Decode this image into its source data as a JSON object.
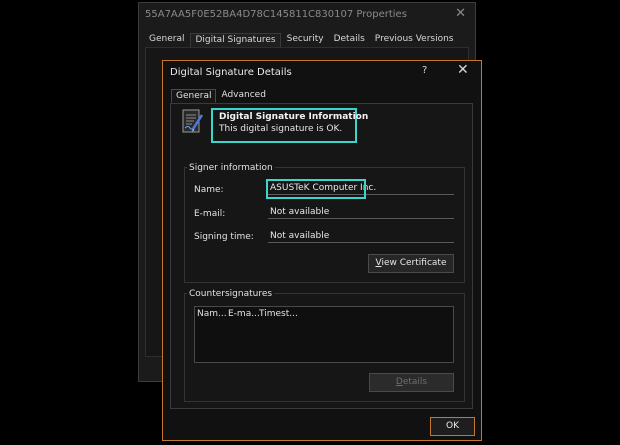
{
  "background_window": {
    "title": "55A7AA5F0E52BA4D78C145811C830107 Properties",
    "close_glyph": "✕",
    "tabs": [
      {
        "label": "General"
      },
      {
        "label": "Digital Signatures"
      },
      {
        "label": "Security"
      },
      {
        "label": "Details"
      },
      {
        "label": "Previous Versions"
      }
    ]
  },
  "dialog": {
    "title": "Digital Signature Details",
    "help_glyph": "?",
    "close_glyph": "✕",
    "tabs": [
      {
        "label": "General"
      },
      {
        "label": "Advanced"
      }
    ],
    "info": {
      "heading": "Digital Signature Information",
      "status": "This digital signature is OK."
    },
    "signer": {
      "group_label": "Signer information",
      "name_label": "Name:",
      "name_value": "ASUSTeK Computer Inc.",
      "email_label": "E-mail:",
      "email_value": "Not available",
      "time_label": "Signing time:",
      "time_value": "Not available",
      "view_cert_underlined": "V",
      "view_cert_rest": "iew Certificate"
    },
    "countersignatures": {
      "group_label": "Countersignatures",
      "columns": [
        "Nam...",
        "E-ma...",
        "Timest..."
      ],
      "details_underlined": "D",
      "details_rest": "etails"
    },
    "ok_label": "OK"
  },
  "colors": {
    "highlight": "#3ad6ce",
    "accent_border": "#c4782e"
  },
  "icons": {
    "signature": "signature-document-icon"
  }
}
